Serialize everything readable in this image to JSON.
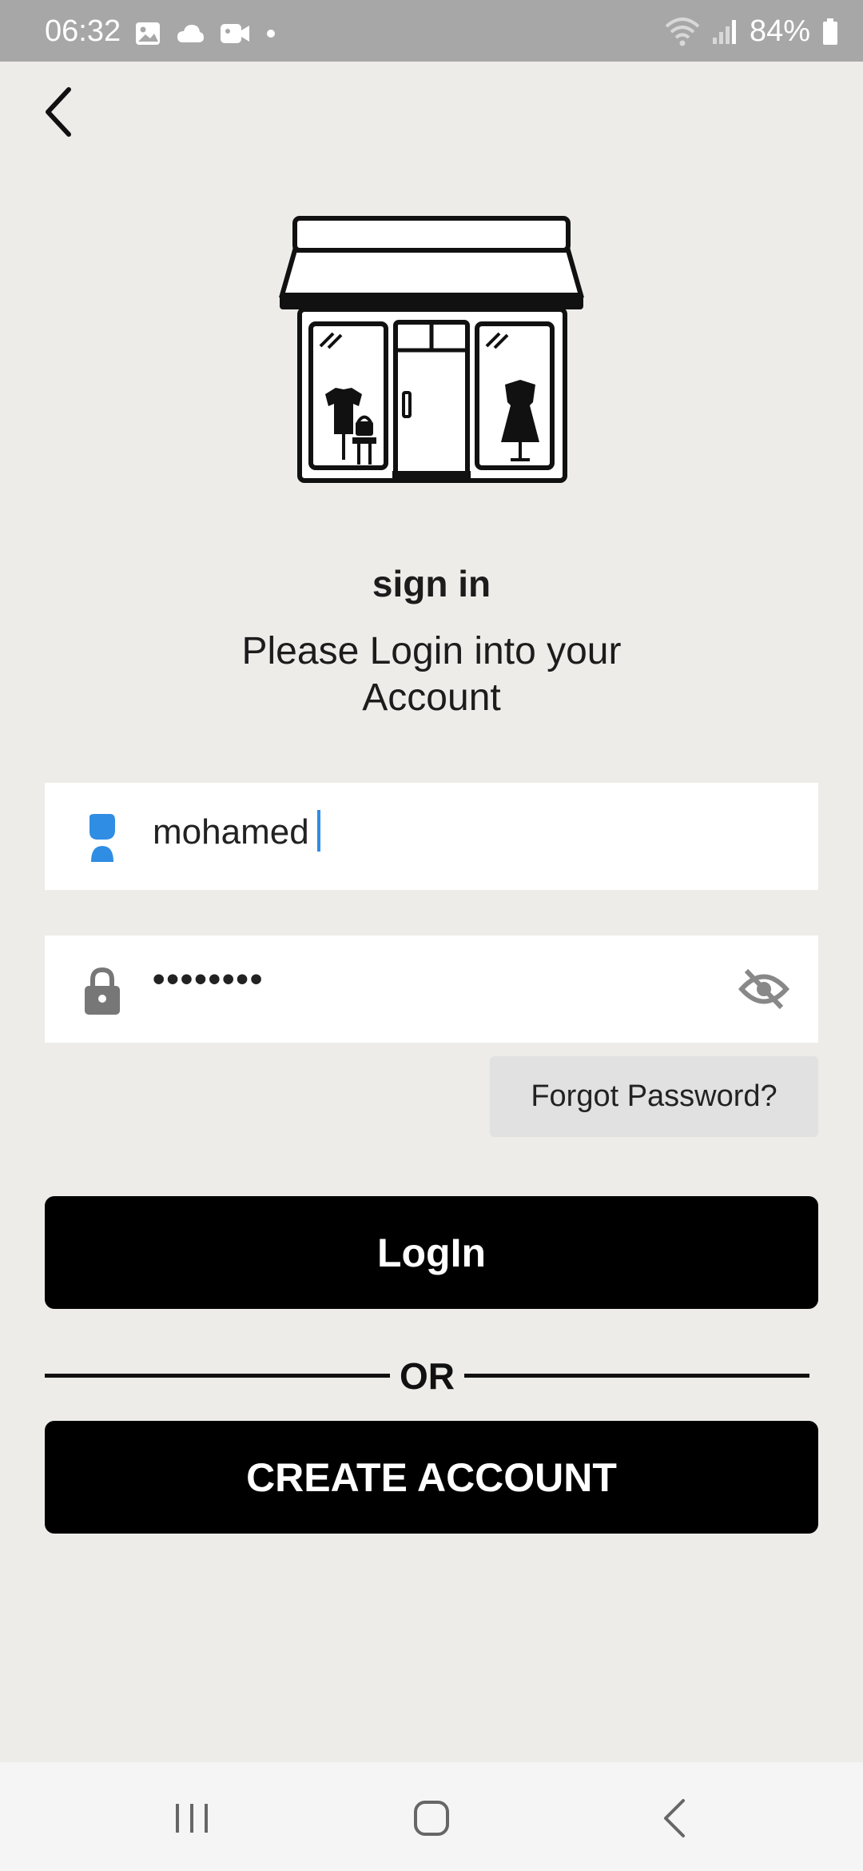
{
  "status_bar": {
    "time": "06:32",
    "battery": "84%",
    "left_icons": [
      "gallery-icon",
      "cloud-icon",
      "video-icon",
      "dot-icon"
    ],
    "right_icons": [
      "wifi-icon",
      "signal-icon",
      "battery-icon"
    ]
  },
  "header": {
    "back_icon": "chevron-left-icon"
  },
  "illustration": {
    "icon": "store-icon"
  },
  "title": "sign in",
  "subtitle": "Please Login into your Account",
  "form": {
    "username": {
      "value": "mohamed",
      "icon": "user-icon",
      "icon_color": "#2f8de4"
    },
    "password": {
      "value": "••••••••",
      "icon": "lock-icon",
      "toggle_icon": "eye-off-icon"
    },
    "forgot_label": "Forgot Password?"
  },
  "actions": {
    "login_label": "LogIn",
    "divider_label": "OR",
    "create_label": "CREATE ACCOUNT"
  },
  "nav": {
    "recents_icon": "recents-icon",
    "home_icon": "home-icon",
    "back_icon": "back-icon"
  }
}
